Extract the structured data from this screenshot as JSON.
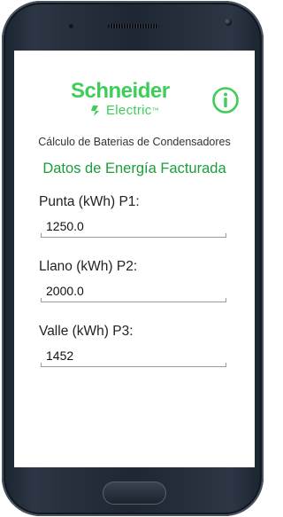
{
  "brand": {
    "name": "Schneider",
    "subtitle": "Electric",
    "trademark": "™",
    "color": "#3dcd58"
  },
  "header": {
    "info_icon": "info-circle-icon"
  },
  "app_title": "Cálculo de Baterias de Condensadores",
  "section_title": "Datos de Energía Facturada",
  "section_color": "#1b9d3a",
  "fields": [
    {
      "label": "Punta (kWh) P1:",
      "value": "1250.0"
    },
    {
      "label": "Llano (kWh) P2:",
      "value": "2000.0"
    },
    {
      "label": "Valle (kWh) P3:",
      "value": "1452"
    }
  ]
}
